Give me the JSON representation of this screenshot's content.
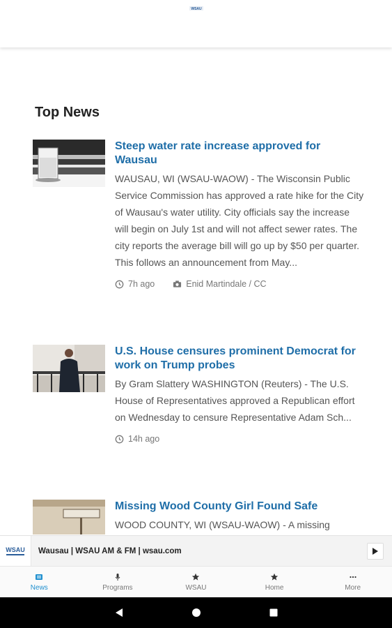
{
  "header": {
    "logo_icon": "wsau-logo-icon"
  },
  "section": {
    "title": "Top News"
  },
  "articles": [
    {
      "headline": "Steep water rate increase approved for Wausau",
      "summary": "WAUSAU, WI (WSAU-WAOW) - The Wisconsin Public Service Commission has approved a rate hike for the City of Wausau's water utility. City officials say the increase will begin on July 1st and will not affect sewer rates. The city reports the average bill will go up by $50 per quarter. This follows an announcement from May...",
      "time": "7h ago",
      "credit": "Enid Martindale / CC"
    },
    {
      "headline": "U.S. House censures prominent Democrat for work on Trump probes",
      "summary": "By Gram Slattery WASHINGTON (Reuters) - The U.S. House of Representatives approved a Republican effort on Wednesday to censure Representative Adam Sch...",
      "time": "14h ago"
    },
    {
      "headline": "Missing Wood County Girl Found Safe",
      "summary": "WOOD COUNTY, WI (WSAU-WAOW) - A missing"
    }
  ],
  "player": {
    "title": "Wausau | WSAU AM & FM | wsau.com",
    "play_icon": "play-icon"
  },
  "tabs": [
    {
      "label": "News",
      "icon": "newspaper-icon",
      "active": true
    },
    {
      "label": "Programs",
      "icon": "microphone-icon"
    },
    {
      "label": "WSAU",
      "icon": "star-icon"
    },
    {
      "label": "Home",
      "icon": "star-icon"
    },
    {
      "label": "More",
      "icon": "more-dots-icon"
    }
  ],
  "system_nav": {
    "back_icon": "back-icon",
    "home_icon": "home-circle-icon",
    "recents_icon": "recents-square-icon"
  },
  "colors": {
    "headline": "#1f6ea8",
    "active_tab": "#1f8fcf",
    "nav_bar": "#000000"
  }
}
